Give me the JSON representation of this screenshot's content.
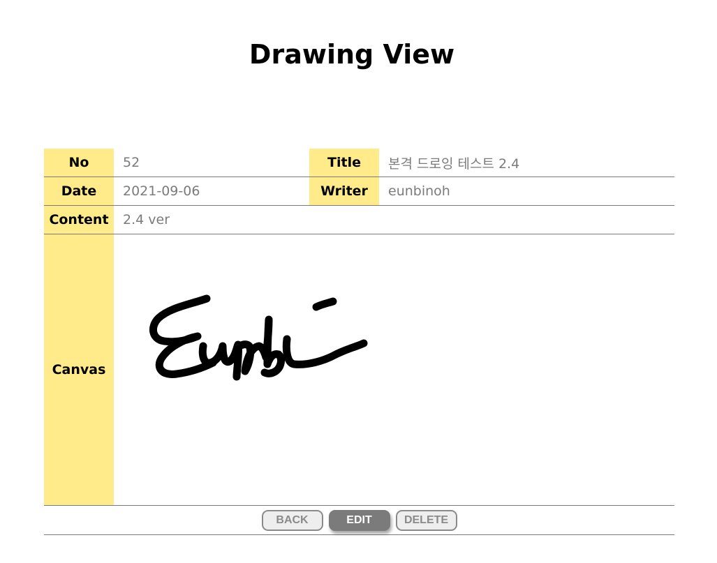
{
  "page": {
    "title": "Drawing View"
  },
  "fields": {
    "no_label": "No",
    "no_value": "52",
    "title_label": "Title",
    "title_value": "본격 드로잉 테스트 2.4",
    "date_label": "Date",
    "date_value": "2021-09-06",
    "writer_label": "Writer",
    "writer_value": "eunbinoh",
    "content_label": "Content",
    "content_value": "2.4 ver",
    "canvas_label": "Canvas"
  },
  "buttons": {
    "back": "BACK",
    "edit": "EDIT",
    "delete": "DELETE"
  },
  "colors": {
    "label_bg": "#ffeb8a",
    "value_text": "#7b7b7b",
    "edit_bg": "#7b7b7b"
  }
}
